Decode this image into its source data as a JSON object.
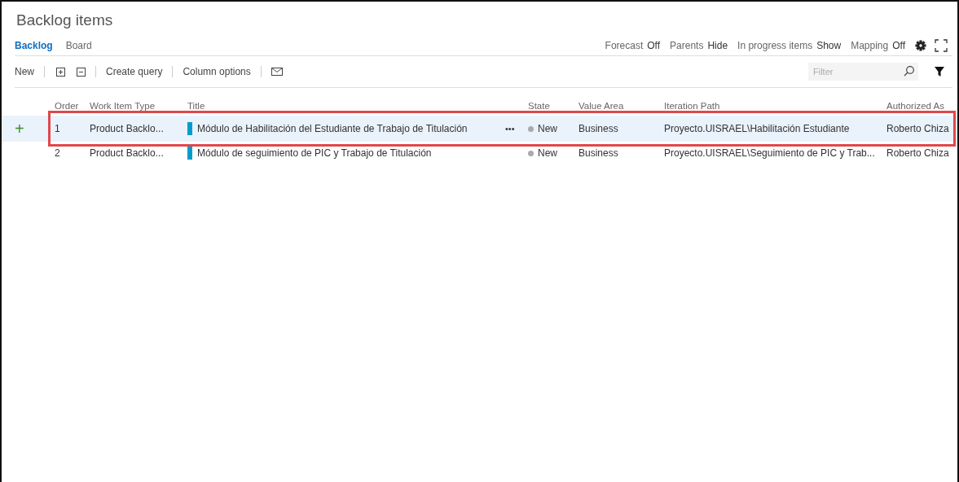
{
  "title": "Backlog items",
  "tabs": [
    {
      "label": "Backlog",
      "selected": true
    },
    {
      "label": "Board",
      "selected": false
    }
  ],
  "view_options": [
    {
      "label": "Forecast",
      "value": "Off"
    },
    {
      "label": "Parents",
      "value": "Hide"
    },
    {
      "label": "In progress items",
      "value": "Show"
    },
    {
      "label": "Mapping",
      "value": "Off"
    }
  ],
  "toolbar": [
    {
      "kind": "text",
      "label": "New"
    },
    {
      "kind": "expand"
    },
    {
      "kind": "collapse"
    },
    {
      "kind": "text",
      "label": "Create query"
    },
    {
      "kind": "text",
      "label": "Column options"
    },
    {
      "kind": "mail"
    }
  ],
  "filter": {
    "placeholder": "Filter"
  },
  "columns": [
    "Order",
    "Work Item Type",
    "Title",
    "State",
    "Value Area",
    "Iteration Path",
    "Authorized As"
  ],
  "rows": [
    {
      "add": "+",
      "order": "1",
      "type": "Product Backlo...",
      "title": "Módulo de Habilitación del Estudiante de Trabajo de Titulación",
      "more": "•••",
      "state": "New",
      "value_area": "Business",
      "iteration_path": "Proyecto.UISRAEL\\Habilitación Estudiante",
      "authorized_as": "Roberto Chiza",
      "selected": true
    },
    {
      "order": "2",
      "type": "Product Backlo...",
      "title": "Módulo de seguimiento de PIC y Trabajo de Titulación",
      "state": "New",
      "value_area": "Business",
      "iteration_path": "Proyecto.UISRAEL\\Seguimiento de PIC y Trab...",
      "authorized_as": "Roberto Chiza",
      "selected": false
    }
  ]
}
